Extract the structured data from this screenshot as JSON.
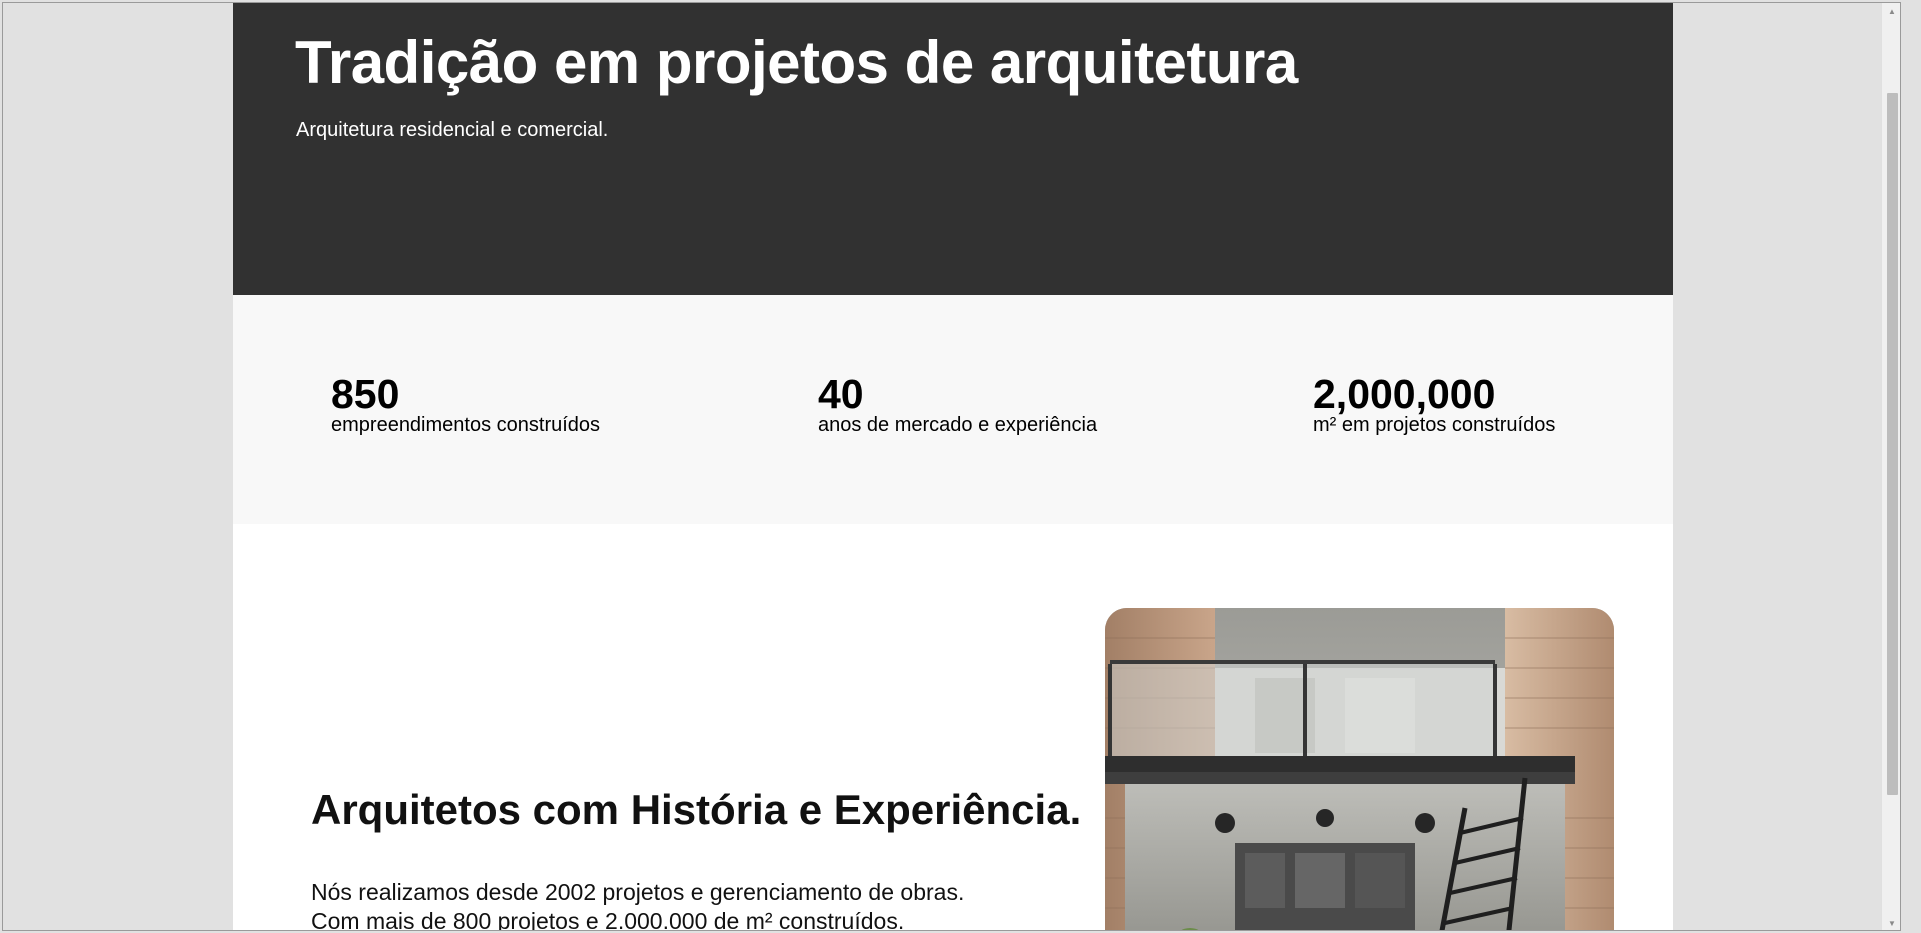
{
  "hero": {
    "title": "Tradição em projetos de arquitetura",
    "subtitle": "Arquitetura residencial e comercial."
  },
  "stats": [
    {
      "value": "850",
      "label": "empreendimentos construídos"
    },
    {
      "value": "40",
      "label": "anos de mercado e experiência"
    },
    {
      "value": "2,000,000",
      "label": "m² em projetos construídos"
    }
  ],
  "about": {
    "heading": "Arquitetos com História e Experiência.",
    "text_line1": "Nós realizamos desde 2002 projetos e gerenciamento de obras.",
    "text_line2": "Com mais de 800 projetos e 2.000.000 de m² construídos."
  },
  "colors": {
    "hero_background": "#313131",
    "stats_background": "#f8f8f8",
    "page_background": "#ffffff",
    "window_background": "#e1e1e1"
  },
  "icons": {
    "scroll_up": "scroll-up-arrow-icon",
    "scroll_down": "scroll-down-arrow-icon"
  }
}
